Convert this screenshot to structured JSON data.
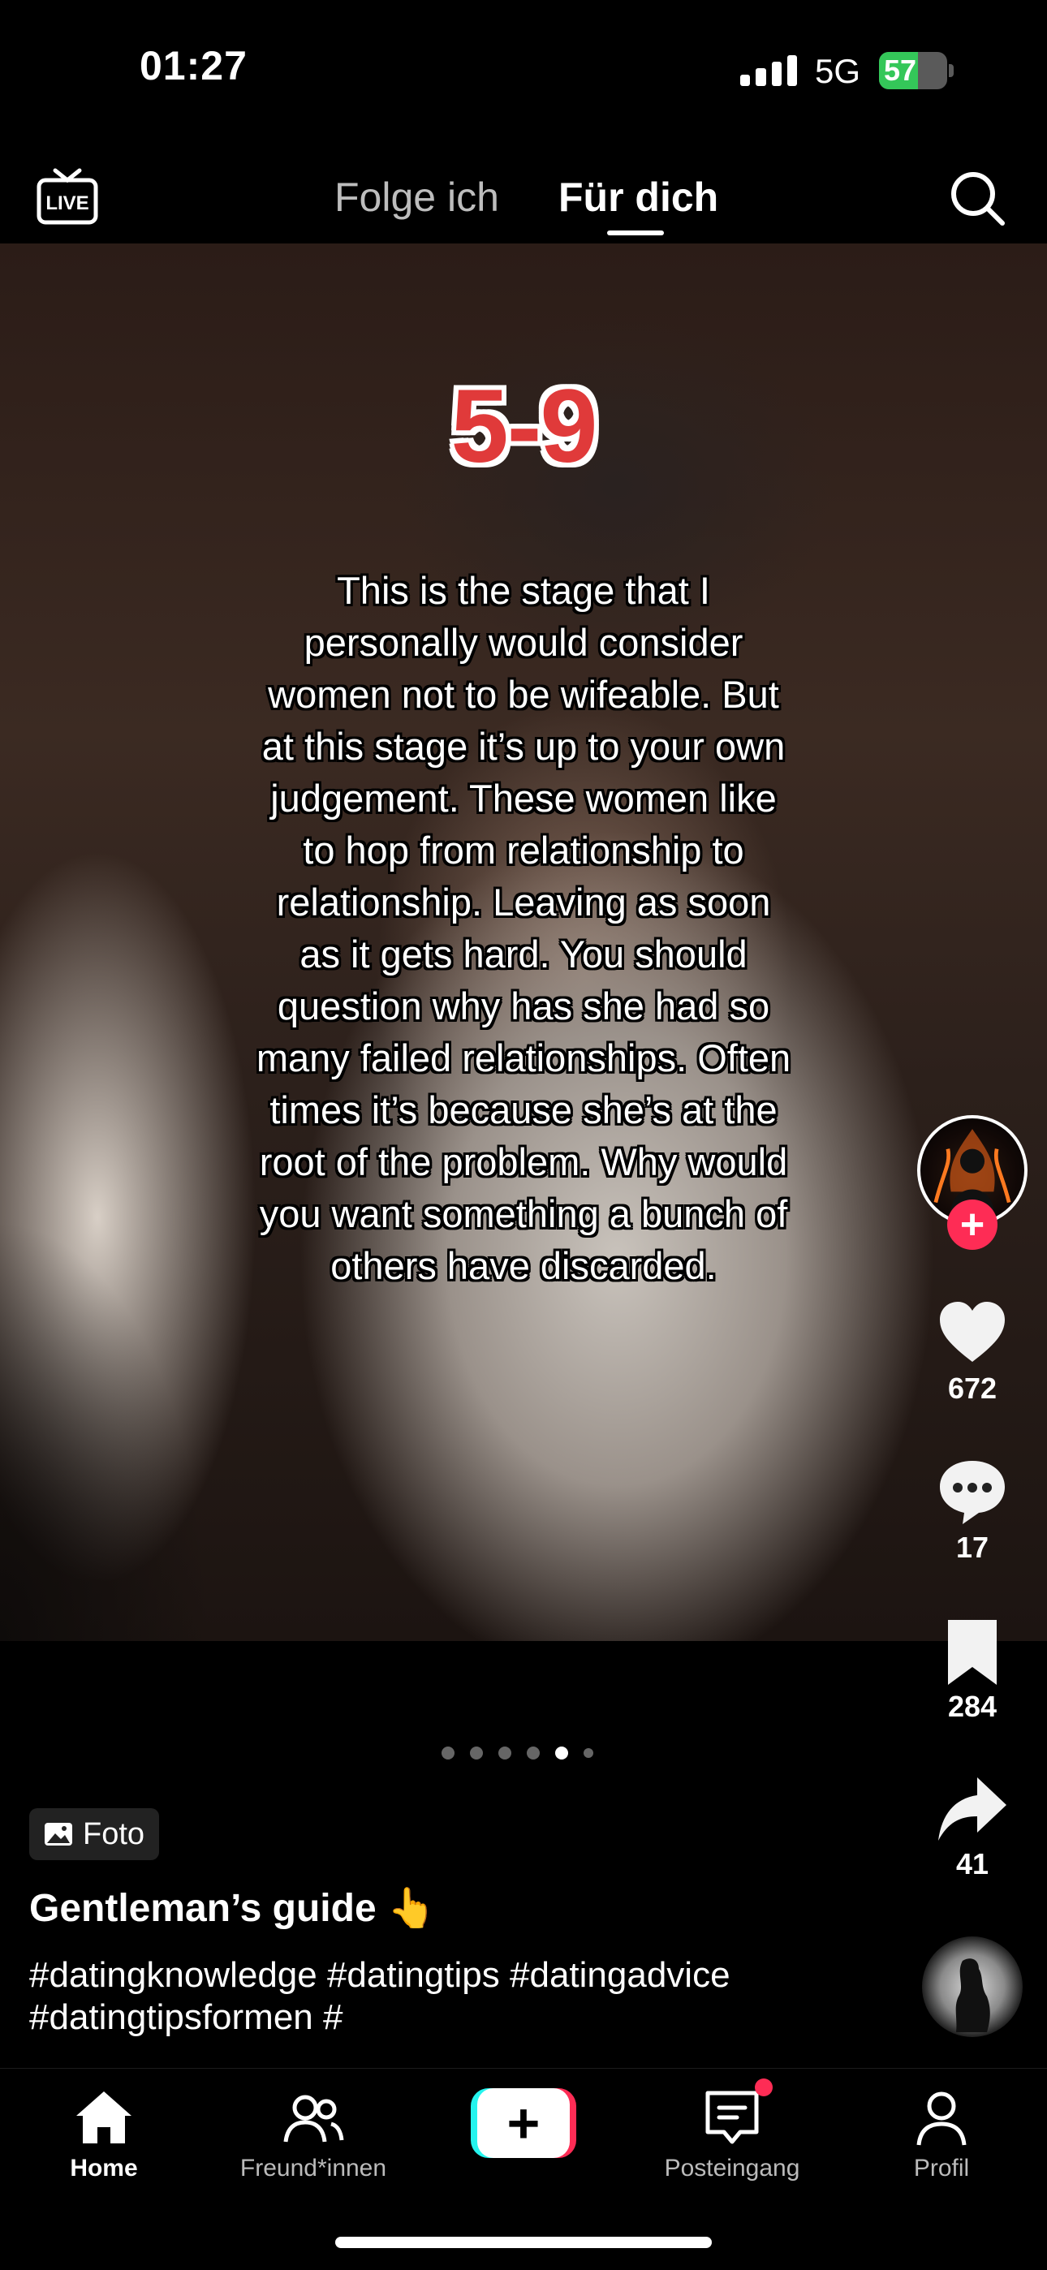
{
  "status_bar": {
    "time": "01:27",
    "network": "5G",
    "battery": "57",
    "battery_level": 0.57
  },
  "top_nav": {
    "tabs": [
      {
        "label": "Folge ich",
        "active": false
      },
      {
        "label": "Für dich",
        "active": true
      }
    ]
  },
  "post": {
    "overlay_score": "5-9",
    "overlay_text": "This is the stage that I personally would consider women not to be wifeable. But at this stage it’s up to your own judgement. These women like to hop from relationship to relationship. Leaving as soon as it gets hard. You should question why has she had so many failed relationships. Often times it’s because she’s at the root of the problem. Why would you want something a bunch of others have discarded.",
    "carousel": {
      "total": 6,
      "active_index": 4
    },
    "type_badge": "Foto",
    "caption_title": "Gentleman’s guide 👆",
    "hashtags": "#datingknowledge #datingtips #datingadvice #datingtipsformen #"
  },
  "actions": {
    "likes": "672",
    "comments": "17",
    "saves": "284",
    "shares": "41"
  },
  "bottom_nav": {
    "items": [
      {
        "label": "Home",
        "icon": "home-icon",
        "active": true
      },
      {
        "label": "Freund*innen",
        "icon": "friends-icon",
        "active": false
      },
      {
        "label": "",
        "icon": "create-plus-icon",
        "active": false
      },
      {
        "label": "Posteingang",
        "icon": "inbox-icon",
        "active": false
      },
      {
        "label": "Profil",
        "icon": "profile-icon",
        "active": false
      }
    ]
  },
  "colors": {
    "accent": "#fe2c55",
    "cyan": "#25f4ee",
    "battery": "#34c759",
    "score": "#e03a3a"
  }
}
